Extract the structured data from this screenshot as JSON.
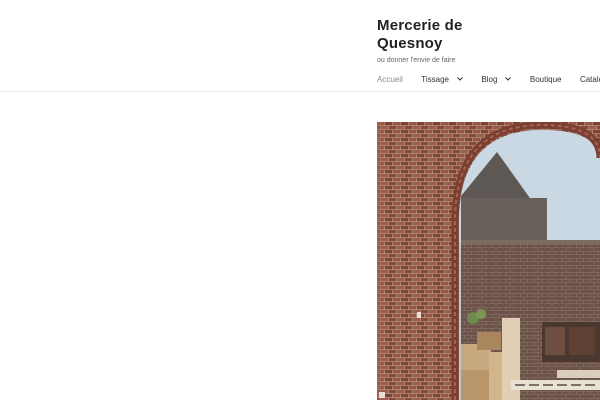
{
  "site": {
    "title": "Mercerie de Quesnoy",
    "tagline": "ou donner l'envie de faire"
  },
  "nav": {
    "items": [
      {
        "label": "Accueil",
        "has_submenu": false,
        "current": true
      },
      {
        "label": "Tissage",
        "has_submenu": true,
        "current": false
      },
      {
        "label": "Blog",
        "has_submenu": true,
        "current": false
      },
      {
        "label": "Boutique",
        "has_submenu": false,
        "current": false
      },
      {
        "label": "Catalogue",
        "has_submenu": true,
        "current": false
      }
    ]
  },
  "colors": {
    "accent_current": "#888888",
    "text": "#222222",
    "brick": "#8a4b3c"
  },
  "icons": {
    "submenu": "chevron-down-icon"
  }
}
